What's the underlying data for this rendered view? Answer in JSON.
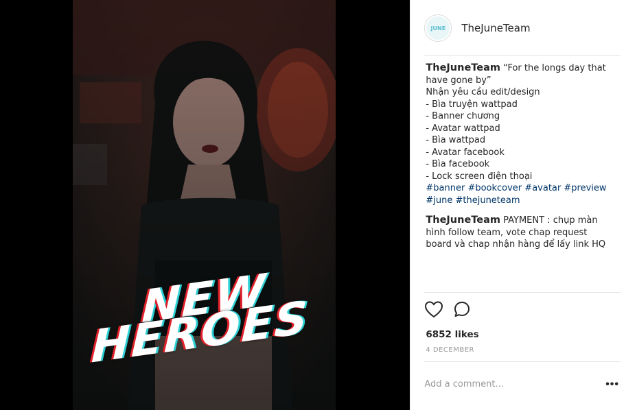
{
  "post": {
    "image": {
      "cover_line1": "NEW",
      "cover_line2": "HEROES"
    },
    "header": {
      "username": "TheJuneTeam"
    },
    "caption": {
      "username": "TheJuneTeam",
      "lines": [
        "“For the longs day that have gone by”",
        "Nhận yêu cầu edit/design",
        "- Bìa truyện wattpad",
        "- Banner chương",
        "- Avatar wattpad",
        "- Bìa wattpad",
        "- Avatar facebook",
        "- Bìa facebook",
        "- Lock screen điện thoại"
      ],
      "hashtags": [
        "#banner",
        "#bookcover",
        "#avatar",
        "#preview",
        "#june",
        "#thejuneteam"
      ]
    },
    "comment": {
      "username": "TheJuneTeam",
      "text": "PAYMENT : chụp màn hình follow team, vote chap request board và chap nhận hàng để lấy link HQ"
    },
    "likes": "6852 likes",
    "date": "4 DECEMBER",
    "add_comment_placeholder": "Add a comment...",
    "more_label": "•••",
    "icons": {
      "like": "heart-icon",
      "comment": "comment-icon",
      "more": "more-options-icon"
    },
    "colors": {
      "hashtag": "#003569",
      "text": "#262626",
      "muted": "#999999"
    }
  }
}
